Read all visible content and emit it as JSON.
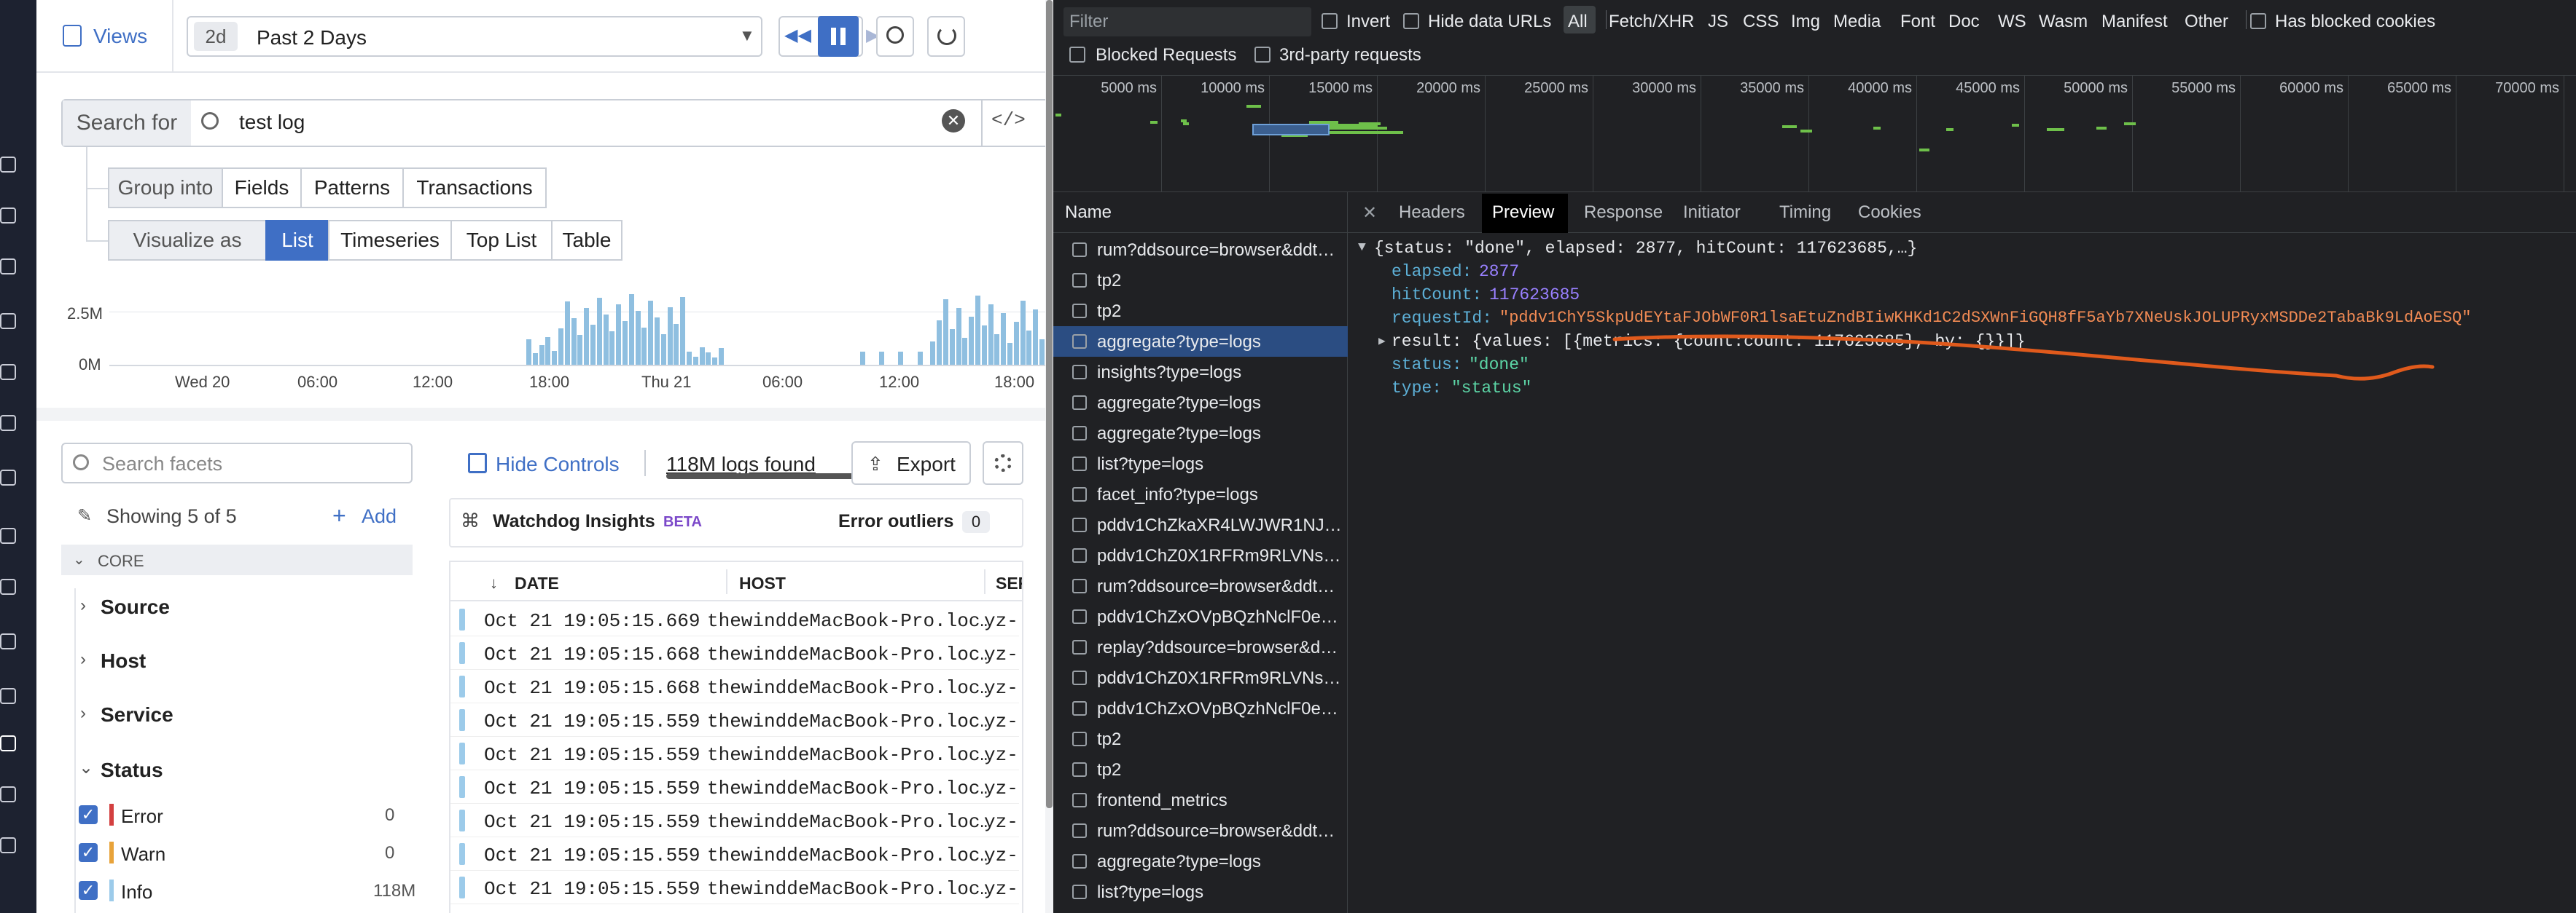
{
  "views": {
    "label": "Views"
  },
  "timepicker": {
    "badge": "2d",
    "label": "Past 2 Days"
  },
  "search": {
    "prefix": "Search for",
    "query": "test log"
  },
  "group": {
    "label": "Group into",
    "options": [
      "Fields",
      "Patterns",
      "Transactions"
    ]
  },
  "visualize": {
    "label": "Visualize as",
    "options": [
      "List",
      "Timeseries",
      "Top List",
      "Table"
    ],
    "selected": "List"
  },
  "histogram": {
    "y_labels": [
      "2.5M",
      "0M"
    ],
    "x_labels": [
      "Wed 20",
      "06:00",
      "12:00",
      "18:00",
      "Thu 21",
      "06:00",
      "12:00",
      "18:00"
    ]
  },
  "facets": {
    "search_placeholder": "Search facets",
    "showing": "Showing 5 of 5",
    "add": "Add",
    "section": "CORE",
    "groups": [
      "Source",
      "Host",
      "Service",
      "Status"
    ],
    "status_items": [
      {
        "name": "Error",
        "count": "0",
        "color": "#d33f3f"
      },
      {
        "name": "Warn",
        "count": "0",
        "color": "#e8a33a"
      },
      {
        "name": "Info",
        "count": "118M",
        "color": "#9ccbea"
      }
    ]
  },
  "controls": {
    "hide": "Hide Controls",
    "found": "118M logs found",
    "export": "Export"
  },
  "watchdog": {
    "title": "Watchdog Insights",
    "beta": "BETA",
    "outliers": "Error outliers",
    "count": "0"
  },
  "table": {
    "columns": [
      "DATE",
      "HOST",
      "SER"
    ],
    "rows": [
      {
        "date": "Oct 21 19:05:15.669",
        "host": "thewinddeMacBook-Pro.loc…",
        "svc": "yz-"
      },
      {
        "date": "Oct 21 19:05:15.668",
        "host": "thewinddeMacBook-Pro.loc…",
        "svc": "yz-"
      },
      {
        "date": "Oct 21 19:05:15.668",
        "host": "thewinddeMacBook-Pro.loc…",
        "svc": "yz-"
      },
      {
        "date": "Oct 21 19:05:15.559",
        "host": "thewinddeMacBook-Pro.loc…",
        "svc": "yz-"
      },
      {
        "date": "Oct 21 19:05:15.559",
        "host": "thewinddeMacBook-Pro.loc…",
        "svc": "yz-"
      },
      {
        "date": "Oct 21 19:05:15.559",
        "host": "thewinddeMacBook-Pro.loc…",
        "svc": "yz-"
      },
      {
        "date": "Oct 21 19:05:15.559",
        "host": "thewinddeMacBook-Pro.loc…",
        "svc": "yz-"
      },
      {
        "date": "Oct 21 19:05:15.559",
        "host": "thewinddeMacBook-Pro.loc…",
        "svc": "yz-"
      },
      {
        "date": "Oct 21 19:05:15.559",
        "host": "thewinddeMacBook-Pro.loc…",
        "svc": "yz-"
      }
    ]
  },
  "devtools": {
    "filter_placeholder": "Filter",
    "invert": "Invert",
    "hide_data_urls": "Hide data URLs",
    "types": [
      "All",
      "Fetch/XHR",
      "JS",
      "CSS",
      "Img",
      "Media",
      "Font",
      "Doc",
      "WS",
      "Wasm",
      "Manifest",
      "Other"
    ],
    "has_blocked_cookies": "Has blocked cookies",
    "blocked_requests": "Blocked Requests",
    "third_party": "3rd-party requests",
    "timeline_ticks": [
      "5000 ms",
      "10000 ms",
      "15000 ms",
      "20000 ms",
      "25000 ms",
      "30000 ms",
      "35000 ms",
      "40000 ms",
      "45000 ms",
      "50000 ms",
      "55000 ms",
      "60000 ms",
      "65000 ms",
      "70000 ms"
    ],
    "name_header": "Name",
    "requests": [
      "rum?ddsource=browser&ddt…",
      "tp2",
      "tp2",
      "aggregate?type=logs",
      "insights?type=logs",
      "aggregate?type=logs",
      "aggregate?type=logs",
      "list?type=logs",
      "facet_info?type=logs",
      "pddv1ChZkaXR4LWJWR1NJ…",
      "pddv1ChZ0X1RFRm9RLVNs…",
      "rum?ddsource=browser&ddt…",
      "pddv1ChZxOVpBQzhNclF0e…",
      "replay?ddsource=browser&d…",
      "pddv1ChZ0X1RFRm9RLVNs…",
      "pddv1ChZxOVpBQzhNclF0e…",
      "tp2",
      "tp2",
      "frontend_metrics",
      "rum?ddsource=browser&ddt…",
      "aggregate?type=logs",
      "list?type=logs"
    ],
    "selected_index": 3,
    "tabs": [
      "Headers",
      "Preview",
      "Response",
      "Initiator",
      "Timing",
      "Cookies"
    ],
    "active_tab": "Preview",
    "preview": {
      "summary": "{status: \"done\", elapsed: 2877, hitCount: 117623685,…}",
      "elapsed_key": "elapsed:",
      "elapsed_val": "2877",
      "hit_key": "hitCount:",
      "hit_val": "117623685",
      "req_key": "requestId:",
      "req_val": "\"pddv1ChY5SkpUdEYtaFJObWF0R1lsaEtuZndBIiwKHKd1C2dSXWnFiGQH8fF5aYb7XNeUskJOLUPRyxMSDDe2TabaBk9LdAoESQ\"",
      "result": "result: {values: [{metrics: {count:count: 117623685}, by: {}}]}",
      "status_key": "status:",
      "status_val": "\"done\"",
      "type_key": "type:",
      "type_val": "\"status\""
    }
  },
  "colors": {
    "accent": "#3f6fc5",
    "devtools_bg": "#202124",
    "selected_row": "#2b4d82",
    "annotation": "#e05a1c",
    "beta": "#7b48c9"
  }
}
